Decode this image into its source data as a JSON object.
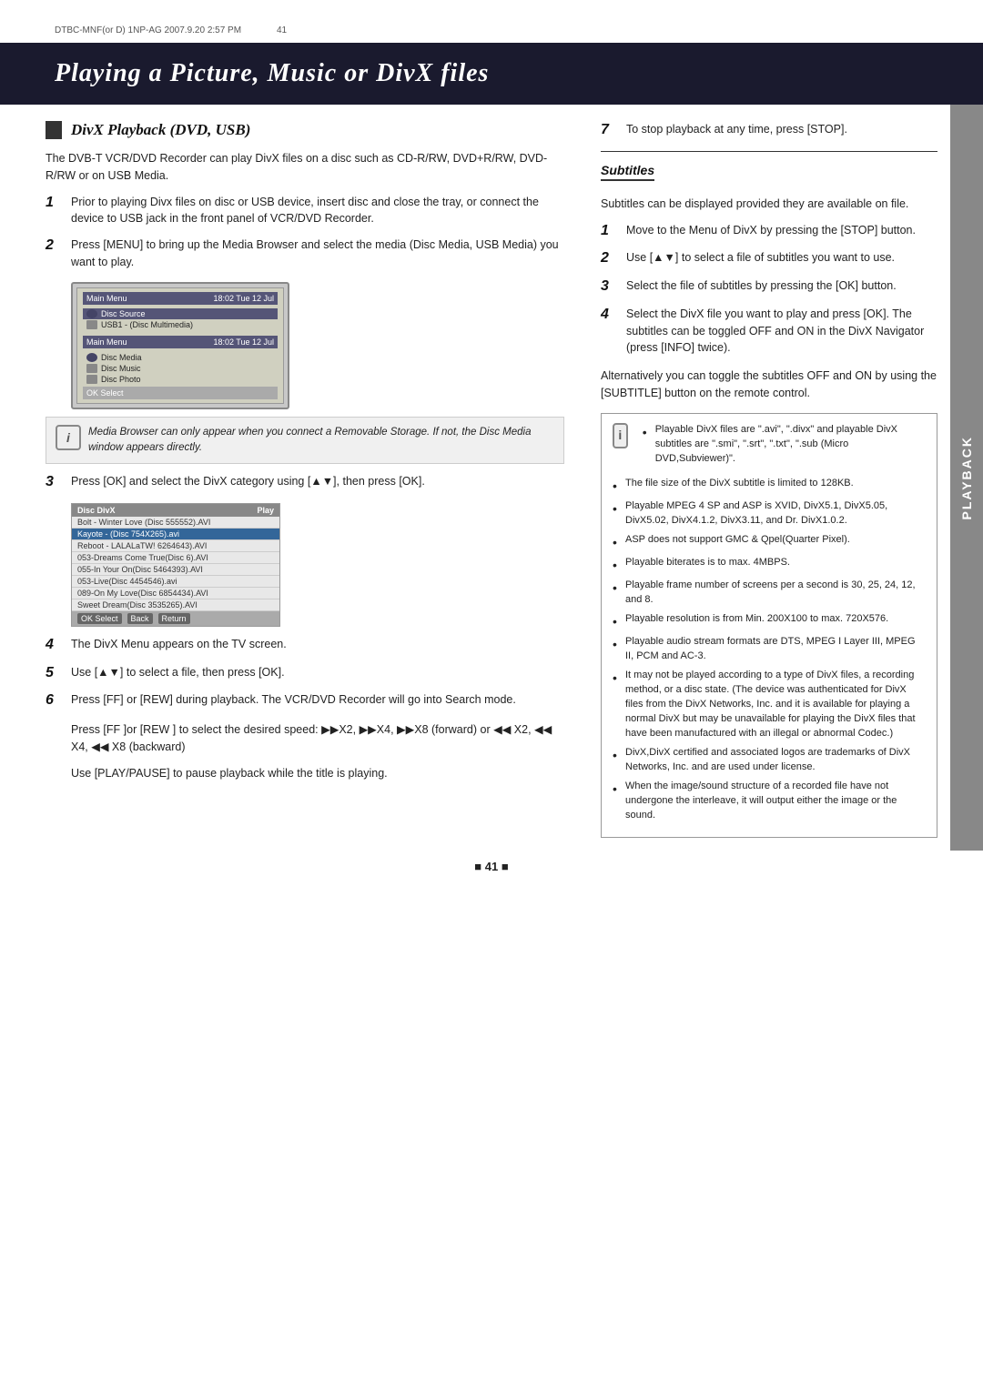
{
  "meta": {
    "header_code": "DTBC-MNF(or D) 1NP-AG 2007.9.20 2:57 PM",
    "page_number_display": "41",
    "page_number": "■ 41 ■"
  },
  "page_title": "Playing a Picture, Music or DivX files",
  "section": {
    "heading": "DivX Playback (DVD, USB)",
    "intro": "The DVB-T VCR/DVD Recorder can play DivX files on a disc such as CD-R/RW, DVD+R/RW, DVD-R/RW or on USB Media.",
    "steps": [
      {
        "number": "1",
        "text": "Prior to playing Divx files on disc or USB device, insert disc and close the tray, or connect the device to USB jack in the front panel of VCR/DVD Recorder."
      },
      {
        "number": "2",
        "text": "Press [MENU] to bring up the Media Browser and select the media (Disc Media, USB Media) you want to play."
      },
      {
        "number": "3",
        "text": "Press [OK] and select the DivX category using [▲▼], then press [OK]."
      },
      {
        "number": "4",
        "text": "The DivX Menu appears on the TV screen."
      },
      {
        "number": "5",
        "text": "Use [▲▼] to select a file, then press [OK]."
      },
      {
        "number": "6",
        "text": "Press [FF] or [REW] during playback. The VCR/DVD Recorder will go into Search mode."
      },
      {
        "number": "6b",
        "text": "Press [FF ]or [REW ] to select the desired speed: ▶▶X2, ▶▶X4, ▶▶X8 (forward) or ◀◀ X2, ◀◀ X4, ◀◀ X8 (backward)"
      },
      {
        "number": "6c",
        "text": "Use [PLAY/PAUSE] to pause playback while the title is playing."
      },
      {
        "number": "7",
        "text": "To stop playback at any time, press [STOP]."
      }
    ],
    "note": "Media Browser can only appear when you connect a Removable Storage. If not, the Disc Media window appears directly."
  },
  "subtitles_section": {
    "heading": "Subtitles",
    "intro": "Subtitles can be displayed provided they are available on file.",
    "steps": [
      {
        "number": "1",
        "text": "Move to the Menu of DivX by pressing the [STOP] button."
      },
      {
        "number": "2",
        "text": "Use [▲▼] to select a file of subtitles you want to use."
      },
      {
        "number": "3",
        "text": "Select the file of subtitles by pressing the [OK] button."
      },
      {
        "number": "4",
        "text": "Select the DivX file you want to play and press [OK]. The subtitles can be toggled OFF and ON in the DivX Navigator (press [INFO] twice)."
      },
      {
        "number": "4b",
        "text": "Alternatively you can toggle the subtitles OFF and ON by using the [SUBTITLE] button on the remote control."
      }
    ]
  },
  "info_bullets": [
    "Playable DivX files are \".avi\", \".divx\" and playable DivX subtitles are \".smi\", \".srt\", \".txt\", \".sub (Micro DVD,Subviewer)\".",
    "The file size of the DivX subtitle is limited to 128KB.",
    "Playable MPEG 4 SP and ASP is XVID, DivX5.1, DivX5.05, DivX5.02, DivX4.1.2, DivX3.11, and Dr. DivX1.0.2.",
    "ASP does not support GMC & Qpel(Quarter Pixel).",
    "Playable biterates is to max. 4MBPS.",
    "Playable frame number of screens per a second is 30, 25, 24, 12, and 8.",
    "Playable resolution is from Min. 200X100 to max. 720X576.",
    "Playable audio stream formats are DTS, MPEG I Layer III, MPEG II, PCM and AC-3.",
    "It may not be played according to a type of DivX files, a recording method, or a disc state. (The device was authenticated for DivX files from the DivX Networks, Inc. and it is available for playing a normal DivX but may be unavailable for playing the DivX files that have been manufactured with an illegal or abnormal Codec.)",
    "DivX,DivX certified and associated logos are trademarks of DivX Networks, Inc. and are used under license.",
    "When the image/sound structure of a recorded file have not undergone the interleave, it will output either the image or the sound."
  ],
  "screen1": {
    "title": "Main Menu",
    "time": "18:02 Tue 12 Jul",
    "items": [
      {
        "label": "Disc Source",
        "selected": true
      },
      {
        "label": "USB1 - (Disc Multimedia)",
        "selected": false
      }
    ],
    "submenu_title": "Main Menu",
    "submenu_time": "18:02 Tue 12 Jul",
    "submenu_items": [
      {
        "label": "Disc Media",
        "selected": false
      },
      {
        "label": "Disc Music",
        "selected": false
      },
      {
        "label": "Disc Photo",
        "selected": false
      }
    ],
    "select_label": "OK Select"
  },
  "disc_table": {
    "title": "Disc DivX",
    "header_play": "Play",
    "rows": [
      "Bolt - Winter Love (Disc 555552).AVI",
      "Kayote - (Disc 754X265).avi",
      "Reboot - LALALaTW! 6264643).AVI",
      "053-Dreams Come True(Disc 6).AVI",
      "055-In Your On(Disc 5464393).AVI",
      "053-Live(Disc 4454546).avi",
      "089-On My Love(Disc 6854434).AVI",
      "Sweet Dream(Disc 3535265).AVI"
    ],
    "footer": [
      "OK Select",
      "Back",
      "Return"
    ]
  },
  "playback_tab": "PLAYBACK"
}
